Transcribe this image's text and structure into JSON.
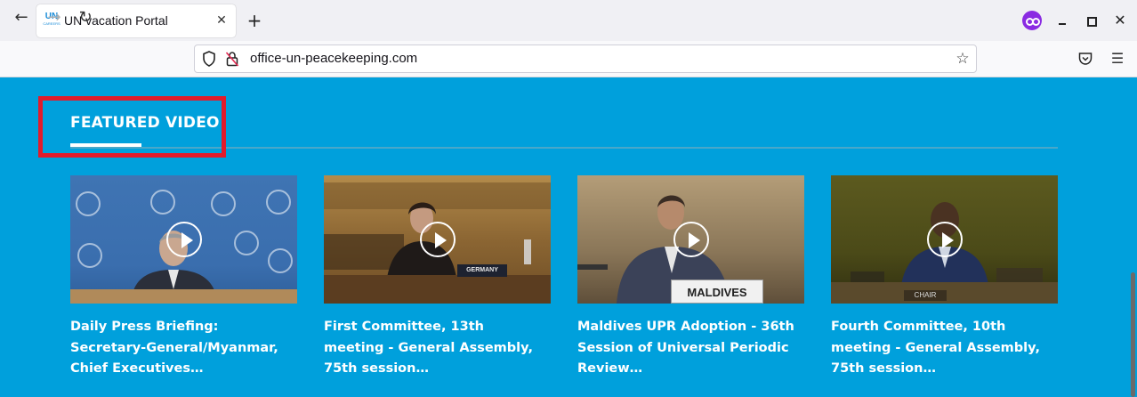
{
  "browser": {
    "tab_title": "UN vacation Portal",
    "favicon_text": "UN",
    "favicon_subtext": "CAREERS",
    "new_tab_label": "+",
    "close_tab_label": "✕",
    "url": "office-un-peacekeeping.com",
    "icons": [
      "back-icon",
      "forward-icon",
      "reload-icon",
      "shield-icon",
      "insecure-lock-icon",
      "bookmark-star-icon",
      "pocket-icon",
      "menu-icon",
      "private-browsing-icon"
    ]
  },
  "section": {
    "title": "FEATURED VIDEO"
  },
  "videos": [
    {
      "title": "Daily Press Briefing: Secretary-General/Myanmar, Chief Executives…"
    },
    {
      "title": "First Committee, 13th meeting - General Assembly, 75th session…",
      "nameplate": "GERMANY"
    },
    {
      "title": "Maldives UPR Adoption - 36th Session of Universal Periodic Review…",
      "nameplate": "MALDIVES"
    },
    {
      "title": "Fourth Committee, 10th meeting - General Assembly, 75th session…",
      "nameplate": "CHAIR"
    }
  ],
  "colors": {
    "page_background": "#00a0dc",
    "highlight_border": "#e21b2b",
    "text": "#ffffff"
  }
}
